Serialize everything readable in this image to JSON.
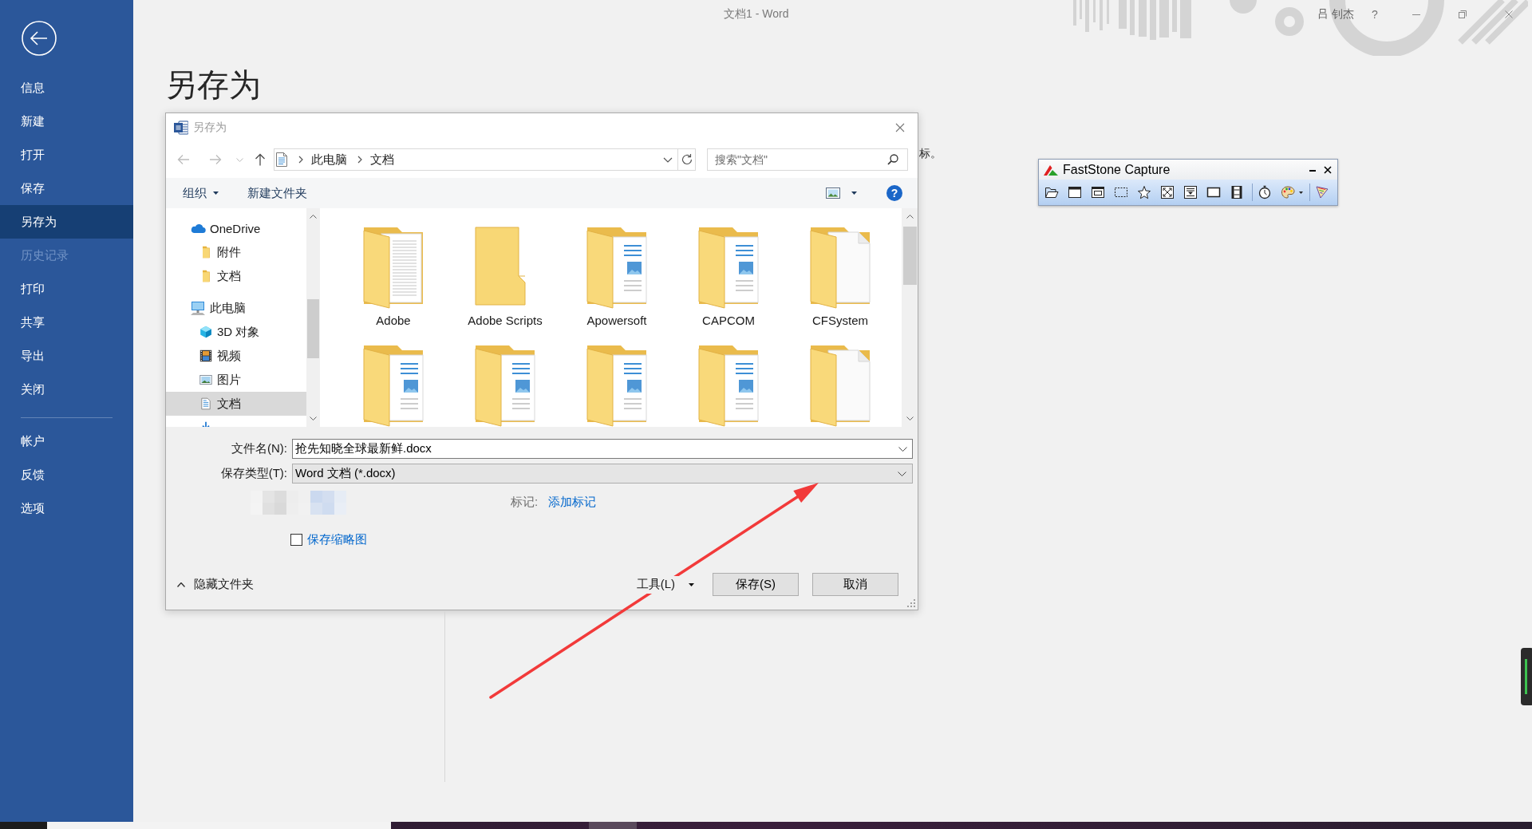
{
  "window": {
    "title": "文档1 - Word",
    "user_name": "吕 钊杰",
    "help": "?"
  },
  "backstage": {
    "menu": [
      {
        "label": "信息",
        "selected": false,
        "disabled": false
      },
      {
        "label": "新建",
        "selected": false,
        "disabled": false
      },
      {
        "label": "打开",
        "selected": false,
        "disabled": false
      },
      {
        "label": "保存",
        "selected": false,
        "disabled": false
      },
      {
        "label": "另存为",
        "selected": true,
        "disabled": false
      },
      {
        "label": "历史记录",
        "selected": false,
        "disabled": true
      },
      {
        "label": "打印",
        "selected": false,
        "disabled": false
      },
      {
        "label": "共享",
        "selected": false,
        "disabled": false
      },
      {
        "label": "导出",
        "selected": false,
        "disabled": false
      },
      {
        "label": "关闭",
        "selected": false,
        "disabled": false
      }
    ],
    "menu_footer": [
      {
        "label": "帐户",
        "selected": false,
        "disabled": false
      },
      {
        "label": "反馈",
        "selected": false,
        "disabled": false
      },
      {
        "label": "选项",
        "selected": false,
        "disabled": false
      }
    ],
    "page_title": "另存为",
    "covered_text": "标。"
  },
  "dialog": {
    "title": "另存为",
    "address_path": [
      "此电脑",
      "文档"
    ],
    "search_placeholder": "搜索\"文档\"",
    "toolbar": {
      "organize": "组织",
      "new_folder": "新建文件夹",
      "help": "?"
    },
    "tree": [
      {
        "label": "OneDrive",
        "kind": "cloud",
        "selected": false,
        "children": [
          {
            "label": "附件",
            "kind": "folder",
            "selected": false
          },
          {
            "label": "文档",
            "kind": "folder",
            "selected": false
          }
        ]
      },
      {
        "label": "此电脑",
        "kind": "computer",
        "selected": false,
        "children": [
          {
            "label": "3D 对象",
            "kind": "objects",
            "selected": false
          },
          {
            "label": "视频",
            "kind": "videos",
            "selected": false
          },
          {
            "label": "图片",
            "kind": "pictures",
            "selected": false
          },
          {
            "label": "文档",
            "kind": "documents",
            "selected": true
          },
          {
            "kind": "downloads",
            "selected": false
          }
        ]
      }
    ],
    "folders": [
      {
        "label": "Adobe",
        "kind": "text"
      },
      {
        "label": "Adobe Scripts",
        "kind": "empty"
      },
      {
        "label": "Apowersoft",
        "kind": "media"
      },
      {
        "label": "CAPCOM",
        "kind": "media"
      },
      {
        "label": "CFSystem",
        "kind": "blank"
      },
      {
        "kind": "media"
      },
      {
        "kind": "media"
      },
      {
        "kind": "media"
      },
      {
        "kind": "media"
      },
      {
        "kind": "blank"
      }
    ],
    "file_name": {
      "label": "文件名(N):",
      "value": "抢先知晓全球最新鲜.docx"
    },
    "file_type": {
      "label": "保存类型(T):",
      "value": "Word 文档 (*.docx)"
    },
    "tags": {
      "label": "标记:",
      "link": "添加标记"
    },
    "thumbnail": {
      "label": "保存缩略图",
      "checked": false
    },
    "hide_folders": "隐藏文件夹",
    "tools": "工具(L)",
    "buttons": [
      "保存(S)",
      "取消"
    ]
  },
  "capture_toolbar": {
    "title": "FastStone Capture"
  }
}
